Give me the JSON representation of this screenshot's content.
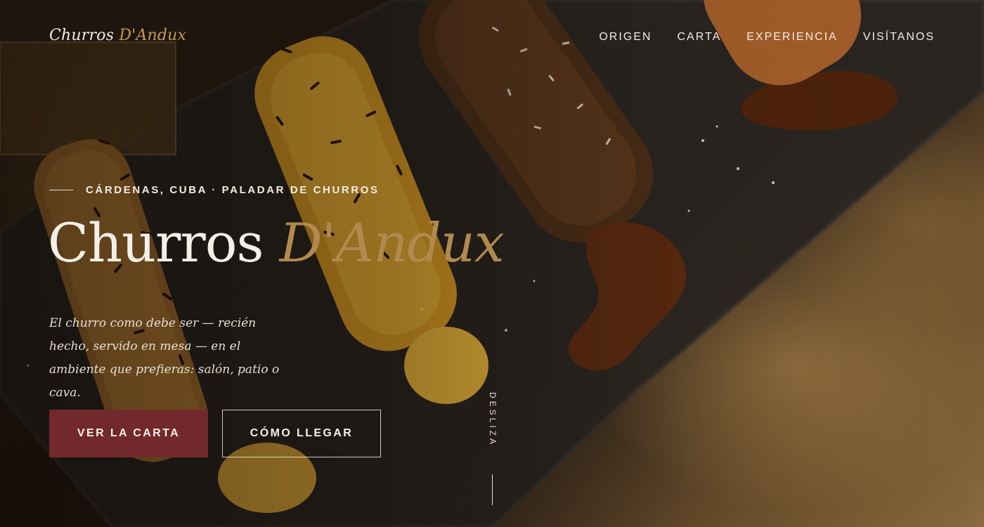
{
  "brand": {
    "name_main": "Churros ",
    "name_accent": "D'Andux"
  },
  "nav": {
    "items": [
      {
        "label": "ORIGEN"
      },
      {
        "label": "CARTA"
      },
      {
        "label": "EXPERIENCIA"
      },
      {
        "label": "VISÍTANOS"
      }
    ]
  },
  "hero": {
    "eyebrow": "CÁRDENAS, CUBA · PALADAR DE CHURROS",
    "title_main": "Churros ",
    "title_accent": "D'Andux",
    "description": "El churro como debe ser — recién hecho, servido en mesa — en el ambiente que prefieras: salón, patio o cava.",
    "primary_cta": "VER LA CARTA",
    "secondary_cta": "CÓMO LLEGAR",
    "scroll_hint": "DESLIZA"
  },
  "colors": {
    "accent_gold": "#b08a4e",
    "primary_button": "#72292b",
    "text_light": "#f4efe7"
  },
  "icons": {
    "background": "churros-photo-image"
  }
}
